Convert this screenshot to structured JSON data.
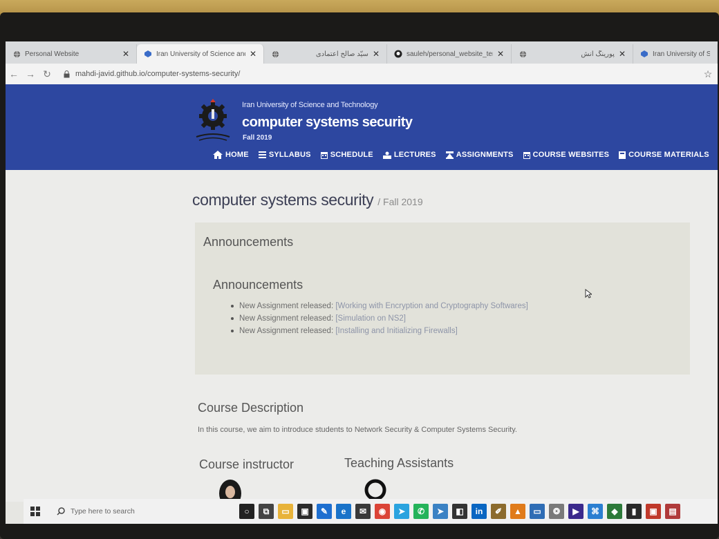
{
  "browser": {
    "tabs": [
      {
        "title": "Personal Website",
        "icon": "globe-icon",
        "active": false
      },
      {
        "title": "Iran University of Science and",
        "icon": "site-icon",
        "active": true
      },
      {
        "title": "سیّد صالح اعتمادی",
        "icon": "globe-icon",
        "active": false
      },
      {
        "title": "sauleh/personal_website_ter",
        "icon": "github-icon",
        "active": false
      },
      {
        "title": "پورینگ آنش",
        "icon": "globe-icon",
        "active": false
      },
      {
        "title": "Iran University of Sc",
        "icon": "site-icon",
        "active": false
      }
    ],
    "close_glyph": "✕",
    "url": "mahdi-javid.github.io/computer-systems-security/"
  },
  "site": {
    "university": "Iran University of Science and Technology",
    "course": "computer systems security",
    "term": "Fall 2019",
    "menu": [
      "HOME",
      "SYLLABUS",
      "SCHEDULE",
      "LECTURES",
      "ASSIGNMENTS",
      "COURSE WEBSITES",
      "COURSE MATERIALS"
    ]
  },
  "page": {
    "title": "computer systems security",
    "subtitle": "/ Fall 2019",
    "announcements_heading": "Announcements",
    "announcements_subheading": "Announcements",
    "announcements": [
      {
        "prefix": "New Assignment released: ",
        "link": "[Working with Encryption and Cryptography Softwares]"
      },
      {
        "prefix": "New Assignment released: ",
        "link": "[Simulation on NS2]"
      },
      {
        "prefix": "New Assignment released: ",
        "link": "[Installing and Initializing Firewalls]"
      }
    ],
    "course_description_heading": "Course Description",
    "course_description": "In this course, we aim to introduce students to Network Security & Computer Systems Security.",
    "instructor_heading": "Course instructor",
    "ta_heading": "Teaching Assistants"
  },
  "taskbar": {
    "search_placeholder": "Type here to search",
    "apps": [
      {
        "name": "cortana-icon",
        "color": "#222222",
        "glyph": "○"
      },
      {
        "name": "task-view-icon",
        "color": "#444444",
        "glyph": "⧉"
      },
      {
        "name": "file-explorer-icon",
        "color": "#e8b33a",
        "glyph": "▭"
      },
      {
        "name": "store-icon",
        "color": "#2b2b2b",
        "glyph": "▣"
      },
      {
        "name": "app-blue-icon",
        "color": "#1e6fd0",
        "glyph": "✎"
      },
      {
        "name": "edge-icon",
        "color": "#1a73c9",
        "glyph": "e"
      },
      {
        "name": "mail-icon",
        "color": "#3a3a3a",
        "glyph": "✉"
      },
      {
        "name": "chrome-icon",
        "color": "#db4437",
        "glyph": "◉"
      },
      {
        "name": "telegram-icon",
        "color": "#2aa3df",
        "glyph": "➤"
      },
      {
        "name": "whatsapp-icon",
        "color": "#25b35a",
        "glyph": "✆"
      },
      {
        "name": "telegram-alt-icon",
        "color": "#3b82c4",
        "glyph": "➤"
      },
      {
        "name": "app-dark-icon",
        "color": "#333333",
        "glyph": "◧"
      },
      {
        "name": "linkedin-icon",
        "color": "#0a66c2",
        "glyph": "in"
      },
      {
        "name": "paint-icon",
        "color": "#8c6b2d",
        "glyph": "✐"
      },
      {
        "name": "vlc-icon",
        "color": "#e07b1a",
        "glyph": "▲"
      },
      {
        "name": "remote-desktop-icon",
        "color": "#2f6db5",
        "glyph": "▭"
      },
      {
        "name": "app-gray-icon",
        "color": "#7a7a7a",
        "glyph": "❂"
      },
      {
        "name": "media-player-icon",
        "color": "#3b2a8c",
        "glyph": "▶"
      },
      {
        "name": "vscode-icon",
        "color": "#2b7fd1",
        "glyph": "⌘"
      },
      {
        "name": "app-green-icon",
        "color": "#2d7a3a",
        "glyph": "◆"
      },
      {
        "name": "terminal-icon",
        "color": "#2a2a2a",
        "glyph": "▮"
      },
      {
        "name": "app-red-icon",
        "color": "#c0392b",
        "glyph": "▣"
      },
      {
        "name": "app-red2-icon",
        "color": "#b03a3a",
        "glyph": "▤"
      }
    ]
  },
  "colors": {
    "header_blue": "#2d47a0",
    "panel_bg": "#e2e2da",
    "link": "#8d94a8"
  }
}
